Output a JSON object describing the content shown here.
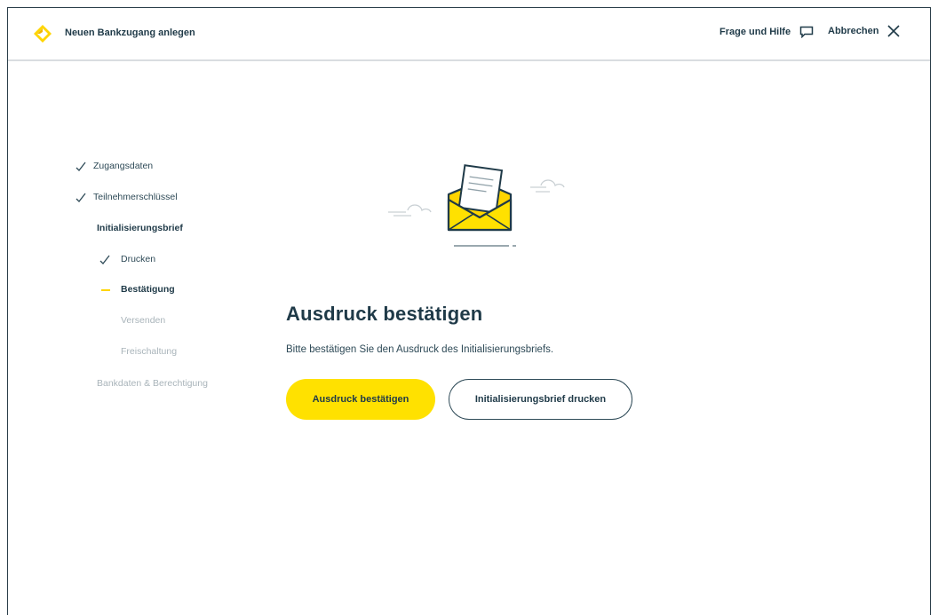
{
  "header": {
    "title": "Neuen Bankzugang anlegen",
    "help_label": "Frage und Hilfe",
    "cancel_label": "Abbrechen"
  },
  "steps": [
    {
      "label": "Zugangsdaten",
      "state": "done"
    },
    {
      "label": "Teilnehmerschlüssel",
      "state": "done"
    },
    {
      "label": "Initialisierungsbrief",
      "state": "group"
    },
    {
      "label": "Drucken",
      "state": "done"
    },
    {
      "label": "Bestätigung",
      "state": "active"
    },
    {
      "label": "Versenden",
      "state": "pending"
    },
    {
      "label": "Freischaltung",
      "state": "pending"
    },
    {
      "label": "Bankdaten & Berechtigung",
      "state": "pending"
    }
  ],
  "main": {
    "title": "Ausdruck bestätigen",
    "description": "Bitte bestätigen Sie den Ausdruck des Initialisierungsbriefs.",
    "primary_button": "Ausdruck bestätigen",
    "secondary_button": "Initialisierungsbrief drucken"
  },
  "icons": {
    "logo": "commerzbank-logo-icon",
    "help": "chat-bubble-icon",
    "cancel": "close-icon",
    "check": "checkmark-icon",
    "illustration": "envelope-letter-icon"
  },
  "colors": {
    "accent": "#ffe100",
    "text": "#1f3a48",
    "muted": "#a9b4ba"
  }
}
